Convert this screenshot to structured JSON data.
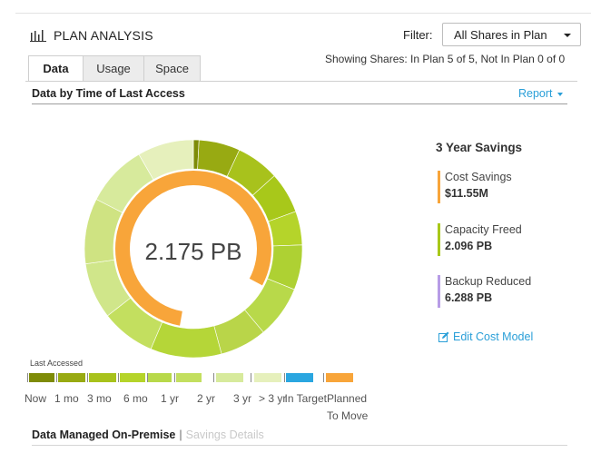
{
  "header": {
    "title": "PLAN ANALYSIS",
    "title_icon": "bar-chart-icon",
    "filter_label": "Filter:",
    "filter_value": "All Shares in Plan",
    "showing_text": "Showing Shares: In Plan 5 of 5, Not In Plan 0 of 0"
  },
  "tabs": [
    {
      "label": "Data",
      "active": true
    },
    {
      "label": "Usage",
      "active": false
    },
    {
      "label": "Space",
      "active": false
    }
  ],
  "section": {
    "title": "Data by Time of Last Access",
    "report_label": "Report"
  },
  "donut": {
    "center_value": "2.175 PB",
    "outer_segments": [
      {
        "start": 0,
        "end": 3,
        "color": "#7e8b07"
      },
      {
        "start": 3,
        "end": 25,
        "color": "#98aa12"
      },
      {
        "start": 25,
        "end": 48,
        "color": "#a8c21c"
      },
      {
        "start": 48,
        "end": 70,
        "color": "#a8c81a"
      },
      {
        "start": 70,
        "end": 88,
        "color": "#b5d42a"
      },
      {
        "start": 88,
        "end": 112,
        "color": "#aed133"
      },
      {
        "start": 112,
        "end": 140,
        "color": "#b8d94a"
      },
      {
        "start": 140,
        "end": 165,
        "color": "#b9d549"
      },
      {
        "start": 165,
        "end": 203,
        "color": "#b5d638"
      },
      {
        "start": 203,
        "end": 232,
        "color": "#c3df5f"
      },
      {
        "start": 232,
        "end": 262,
        "color": "#d0e68a"
      },
      {
        "start": 262,
        "end": 297,
        "color": "#cfe382"
      },
      {
        "start": 297,
        "end": 330,
        "color": "#d7ea9c"
      },
      {
        "start": 330,
        "end": 360,
        "color": "#e6f0bc"
      }
    ],
    "inner_arc": {
      "start": 190,
      "end": 478,
      "color": "#f8a53a"
    }
  },
  "savings": {
    "title": "3 Year Savings",
    "items": [
      {
        "label": "Cost Savings",
        "value": "$11.55M",
        "color": "#f8a53a"
      },
      {
        "label": "Capacity Freed",
        "value": "2.096 PB",
        "color": "#a8c81a"
      },
      {
        "label": "Backup Reduced",
        "value": "6.288 PB",
        "color": "#b79ce6"
      }
    ],
    "edit_label": "Edit Cost Model"
  },
  "legend": {
    "title": "Last Accessed",
    "items": [
      {
        "label": "Now",
        "color": "#7e8b07"
      },
      {
        "label": "1 mo",
        "color": "#98aa12"
      },
      {
        "label": "3 mo",
        "color": "#a8c21c"
      },
      {
        "label": "6 mo",
        "color": "#b5d42a"
      },
      {
        "label": "1 yr",
        "color": "#b8d94a"
      },
      {
        "label": "2 yr",
        "color": "#c3df5f"
      },
      {
        "label": "3 yr",
        "color": "#d7ea9c"
      },
      {
        "label": "> 3 yr",
        "color": "#e6f0bc"
      },
      {
        "label": "In Target",
        "color": "#2aa6e0"
      },
      {
        "label": "Planned To Move",
        "color": "#f8a53a"
      }
    ]
  },
  "bottom": {
    "active_label": "Data Managed On-Premise",
    "separator": "|",
    "inactive_label": "Savings Details"
  }
}
